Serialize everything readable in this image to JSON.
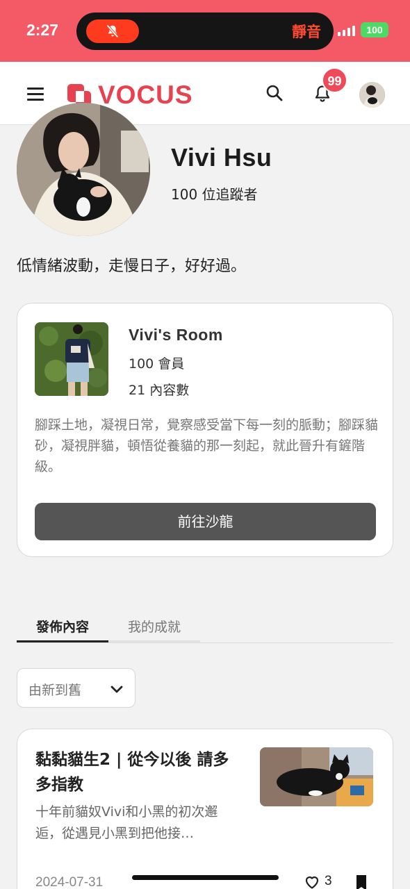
{
  "status_bar": {
    "time": "2:27",
    "silent_label": "靜音",
    "battery": "100",
    "icons": [
      "bell-slash-icon",
      "signal-icon",
      "battery-icon"
    ]
  },
  "header": {
    "logo_text": "VOCUS",
    "notification_count": "99",
    "icons": [
      "menu-icon",
      "search-icon",
      "bell-icon"
    ]
  },
  "profile": {
    "name": "Vivi Hsu",
    "followers": "100 位追蹤者",
    "bio": "低情緒波動，走慢日子，好好過。"
  },
  "salon": {
    "name": "Vivi's Room",
    "members": "100 會員",
    "posts": "21 內容數",
    "description": "腳踩土地，凝視日常，覺察感受當下每一刻的脈動；腳踩貓砂，凝視胖貓，頓悟從養貓的那一刻起，就此晉升有鏟階級。",
    "button_label": "前往沙龍"
  },
  "tabs": [
    {
      "label": "發佈內容",
      "active": true
    },
    {
      "label": "我的成就",
      "active": false
    }
  ],
  "sort": {
    "selected": "由新到舊"
  },
  "article": {
    "title": "黏黏貓生2 | 從今以後 請多多指教",
    "excerpt": "十年前貓奴Vivi和小黑的初次邂逅，從遇見小黑到把他接…",
    "date": "2024-07-31",
    "likes": "3"
  },
  "colors": {
    "status_bar": "#f45a66",
    "brand": "#e8414f",
    "badge": "#ef4a5a",
    "button": "#555555"
  }
}
